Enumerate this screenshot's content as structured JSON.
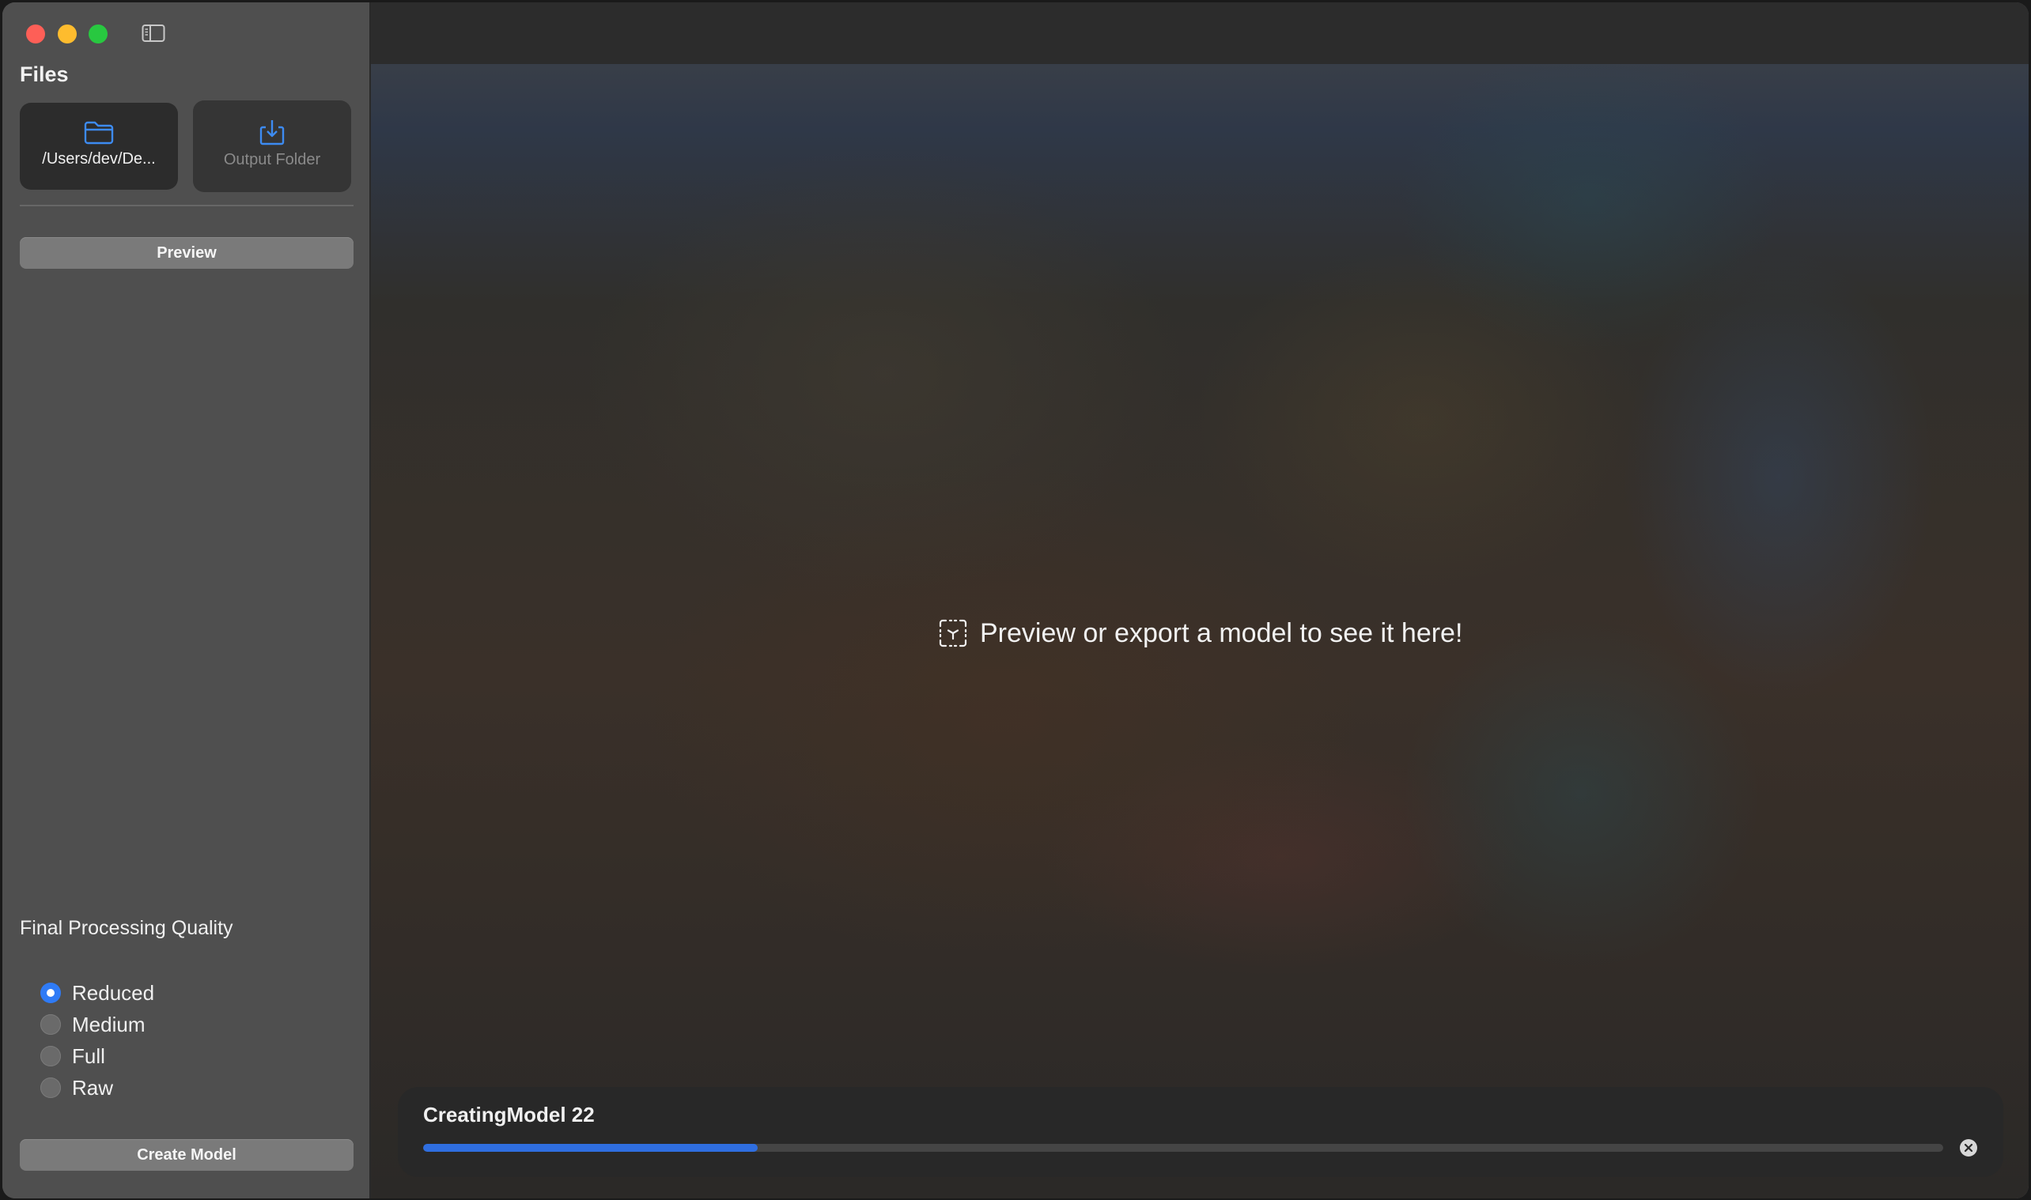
{
  "sidebar": {
    "files_title": "Files",
    "input_folder_label": "/Users/dev/De...",
    "output_folder_label": "Output Folder",
    "preview_label": "Preview",
    "quality_title": "Final Processing Quality",
    "quality_options": [
      {
        "label": "Reduced",
        "selected": true
      },
      {
        "label": "Medium",
        "selected": false
      },
      {
        "label": "Full",
        "selected": false
      },
      {
        "label": "Raw",
        "selected": false
      }
    ],
    "create_label": "Create Model"
  },
  "main": {
    "empty_message": "Preview or export a model to see it here!",
    "progress": {
      "title": "CreatingModel 22",
      "fraction": 0.22
    }
  },
  "colors": {
    "accent": "#2f7bf6",
    "progress_fill": "#2f6ee0",
    "close": "#fe5f57",
    "minimize": "#febc2e",
    "maximize": "#28c840"
  },
  "icons": {
    "input_folder": "folder-icon",
    "output_folder": "download-tray-icon",
    "empty_state": "ar-model-icon",
    "cancel": "x-circle-icon",
    "sidebar_toggle": "sidebar-toggle-icon"
  }
}
